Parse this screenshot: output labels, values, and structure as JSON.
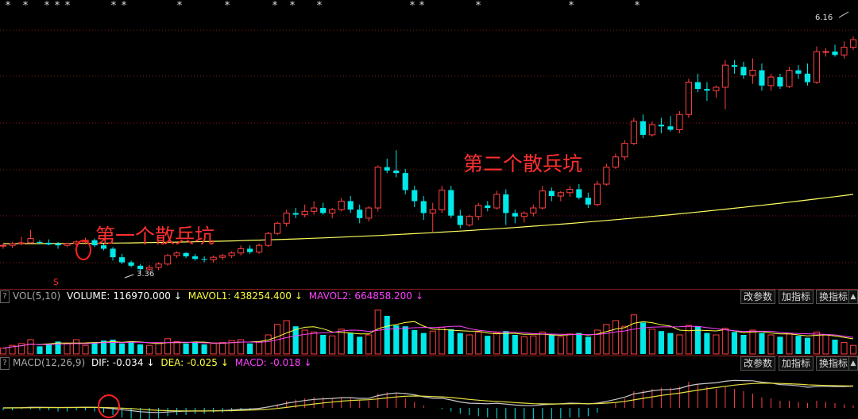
{
  "price_pane": {
    "annotations": [
      "第一个散兵坑",
      "第二个散兵坑"
    ],
    "high_label": "6.16",
    "low_label": "3.36",
    "marker_s": "S",
    "star_marks": [
      "*",
      "*",
      "*",
      "*",
      "*",
      "*",
      "*",
      "*",
      "*",
      "*",
      "*",
      "*",
      "*",
      "*",
      "*",
      "*",
      "*"
    ]
  },
  "vol_pane": {
    "indicator": "VOL(5,10)",
    "volume_label": "VOLUME:",
    "volume_value": "116970.000",
    "mavol1_label": "MAVOL1:",
    "mavol1_value": "438254.400",
    "mavol2_label": "MAVOL2:",
    "mavol2_value": "664858.200",
    "buttons": [
      "改参数",
      "加指标",
      "换指标"
    ]
  },
  "macd_pane": {
    "indicator": "MACD(12,26,9)",
    "dif_label": "DIF:",
    "dif_value": "-0.034",
    "dea_label": "DEA:",
    "dea_value": "-0.025",
    "macd_label": "MACD:",
    "macd_value": "-0.018",
    "buttons": [
      "改参数",
      "加指标",
      "换指标"
    ]
  },
  "colors": {
    "up": "#ff4040",
    "down": "#00e8e8",
    "ma_line": "#ffff60",
    "mavol1": "#ffff40",
    "mavol2": "#ff40ff",
    "dif": "#c8c8c8",
    "dea": "#e8e040",
    "annotation": "#ff3030"
  },
  "chart_data": {
    "type": "candlestick",
    "series": [
      {
        "name": "K",
        "ohlc": [
          [
            3.7,
            3.72,
            3.66,
            3.7
          ],
          [
            3.7,
            3.74,
            3.67,
            3.72
          ],
          [
            3.72,
            3.8,
            3.7,
            3.73
          ],
          [
            3.73,
            3.88,
            3.72,
            3.78
          ],
          [
            3.74,
            3.76,
            3.71,
            3.73
          ],
          [
            3.73,
            3.77,
            3.7,
            3.71
          ],
          [
            3.72,
            3.74,
            3.66,
            3.7
          ],
          [
            3.7,
            3.73,
            3.68,
            3.72
          ],
          [
            3.72,
            3.76,
            3.7,
            3.74
          ],
          [
            3.74,
            3.79,
            3.71,
            3.76
          ],
          [
            3.76,
            3.78,
            3.68,
            3.7
          ],
          [
            3.7,
            3.72,
            3.64,
            3.66
          ],
          [
            3.66,
            3.68,
            3.52,
            3.56
          ],
          [
            3.56,
            3.6,
            3.48,
            3.5
          ],
          [
            3.5,
            3.52,
            3.44,
            3.46
          ],
          [
            3.46,
            3.48,
            3.36,
            3.42
          ],
          [
            3.42,
            3.47,
            3.4,
            3.44
          ],
          [
            3.44,
            3.5,
            3.41,
            3.48
          ],
          [
            3.48,
            3.6,
            3.46,
            3.58
          ],
          [
            3.58,
            3.63,
            3.55,
            3.61
          ],
          [
            3.61,
            3.62,
            3.55,
            3.57
          ],
          [
            3.57,
            3.6,
            3.52,
            3.54
          ],
          [
            3.54,
            3.57,
            3.5,
            3.53
          ],
          [
            3.53,
            3.58,
            3.5,
            3.56
          ],
          [
            3.56,
            3.6,
            3.53,
            3.58
          ],
          [
            3.58,
            3.63,
            3.55,
            3.61
          ],
          [
            3.61,
            3.7,
            3.58,
            3.66
          ],
          [
            3.66,
            3.7,
            3.6,
            3.62
          ],
          [
            3.62,
            3.72,
            3.6,
            3.7
          ],
          [
            3.7,
            3.86,
            3.68,
            3.84
          ],
          [
            3.84,
            3.98,
            3.82,
            3.96
          ],
          [
            3.96,
            4.12,
            3.92,
            4.08
          ],
          [
            4.08,
            4.14,
            4.02,
            4.06
          ],
          [
            4.06,
            4.18,
            4.03,
            4.1
          ],
          [
            4.1,
            4.22,
            4.06,
            4.14
          ],
          [
            4.14,
            4.2,
            4.06,
            4.08
          ],
          [
            4.08,
            4.14,
            4.02,
            4.12
          ],
          [
            4.12,
            4.26,
            4.1,
            4.22
          ],
          [
            4.22,
            4.28,
            4.08,
            4.12
          ],
          [
            4.12,
            4.18,
            3.96,
            4.02
          ],
          [
            4.02,
            4.16,
            3.98,
            4.14
          ],
          [
            4.14,
            4.64,
            4.1,
            4.62
          ],
          [
            4.62,
            4.72,
            4.55,
            4.58
          ],
          [
            4.58,
            4.82,
            4.5,
            4.55
          ],
          [
            4.55,
            4.6,
            4.3,
            4.35
          ],
          [
            4.35,
            4.4,
            4.15,
            4.22
          ],
          [
            4.22,
            4.28,
            4.0,
            4.08
          ],
          [
            4.08,
            4.2,
            3.86,
            4.12
          ],
          [
            4.12,
            4.4,
            4.08,
            4.35
          ],
          [
            4.35,
            4.4,
            4.02,
            4.05
          ],
          [
            4.05,
            4.12,
            3.9,
            3.94
          ],
          [
            3.94,
            4.06,
            3.92,
            4.04
          ],
          [
            4.04,
            4.2,
            4.0,
            4.17
          ],
          [
            4.17,
            4.22,
            4.1,
            4.14
          ],
          [
            4.14,
            4.34,
            4.12,
            4.3
          ],
          [
            4.3,
            4.36,
            3.94,
            4.08
          ],
          [
            4.08,
            4.12,
            3.96,
            4.04
          ],
          [
            4.04,
            4.1,
            3.97,
            4.08
          ],
          [
            4.08,
            4.18,
            4.04,
            4.14
          ],
          [
            4.14,
            4.4,
            4.12,
            4.34
          ],
          [
            4.34,
            4.38,
            4.22,
            4.28
          ],
          [
            4.28,
            4.34,
            4.22,
            4.32
          ],
          [
            4.32,
            4.4,
            4.27,
            4.36
          ],
          [
            4.36,
            4.42,
            4.24,
            4.26
          ],
          [
            4.26,
            4.32,
            4.14,
            4.18
          ],
          [
            4.18,
            4.46,
            4.16,
            4.42
          ],
          [
            4.42,
            4.66,
            4.4,
            4.62
          ],
          [
            4.62,
            4.78,
            4.6,
            4.74
          ],
          [
            4.74,
            4.94,
            4.7,
            4.9
          ],
          [
            4.9,
            5.2,
            4.88,
            5.16
          ],
          [
            5.16,
            5.24,
            4.96,
            5.0
          ],
          [
            5.0,
            5.16,
            4.98,
            5.12
          ],
          [
            5.12,
            5.2,
            5.02,
            5.1
          ],
          [
            5.1,
            5.22,
            5.04,
            5.06
          ],
          [
            5.06,
            5.28,
            5.02,
            5.24
          ],
          [
            5.24,
            5.66,
            5.2,
            5.62
          ],
          [
            5.62,
            5.72,
            5.5,
            5.54
          ],
          [
            5.54,
            5.62,
            5.4,
            5.52
          ],
          [
            5.52,
            5.58,
            5.44,
            5.56
          ],
          [
            5.56,
            5.88,
            5.3,
            5.82
          ],
          [
            5.82,
            5.88,
            5.72,
            5.8
          ],
          [
            5.8,
            5.86,
            5.66,
            5.7
          ],
          [
            5.7,
            5.9,
            5.6,
            5.76
          ],
          [
            5.76,
            5.84,
            5.52,
            5.58
          ],
          [
            5.58,
            5.72,
            5.52,
            5.68
          ],
          [
            5.68,
            5.72,
            5.54,
            5.57
          ],
          [
            5.57,
            5.8,
            5.55,
            5.76
          ],
          [
            5.76,
            5.82,
            5.66,
            5.72
          ],
          [
            5.72,
            5.84,
            5.58,
            5.62
          ],
          [
            5.62,
            6.04,
            5.6,
            5.98
          ],
          [
            5.98,
            6.02,
            5.92,
            5.98
          ],
          [
            5.98,
            6.06,
            5.92,
            5.94
          ],
          [
            5.94,
            6.1,
            5.9,
            6.03
          ],
          [
            6.03,
            6.16,
            6.0,
            6.12
          ]
        ]
      },
      {
        "name": "MA",
        "values_hint": "long moving average rising from 3.72 to 4.30"
      },
      {
        "name": "VOLUME",
        "values": [
          12,
          18,
          22,
          30,
          16,
          20,
          26,
          22,
          30,
          18,
          24,
          28,
          30,
          22,
          26,
          20,
          18,
          22,
          32,
          26,
          22,
          24,
          20,
          22,
          24,
          28,
          30,
          22,
          26,
          40,
          62,
          70,
          58,
          50,
          46,
          40,
          38,
          52,
          44,
          36,
          40,
          92,
          80,
          60,
          58,
          50,
          44,
          48,
          56,
          52,
          44,
          40,
          46,
          38,
          44,
          48,
          40,
          36,
          38,
          46,
          40,
          36,
          42,
          44,
          36,
          50,
          62,
          70,
          58,
          82,
          66,
          52,
          48,
          44,
          40,
          60,
          58,
          44,
          40,
          54,
          46,
          40,
          50,
          44,
          40,
          36,
          42,
          38,
          34,
          46,
          40,
          30,
          24,
          18
        ]
      },
      {
        "name": "MACD",
        "values": [
          -0.02,
          -0.02,
          -0.01,
          -0.01,
          -0.02,
          -0.02,
          -0.03,
          -0.03,
          -0.02,
          -0.02,
          -0.03,
          -0.04,
          -0.06,
          -0.08,
          -0.09,
          -0.1,
          -0.1,
          -0.09,
          -0.07,
          -0.06,
          -0.06,
          -0.05,
          -0.05,
          -0.04,
          -0.04,
          -0.03,
          -0.02,
          -0.02,
          -0.01,
          0.01,
          0.03,
          0.06,
          0.07,
          0.08,
          0.09,
          0.09,
          0.08,
          0.09,
          0.08,
          0.06,
          0.06,
          0.12,
          0.13,
          0.12,
          0.08,
          0.05,
          0.02,
          0.0,
          -0.01,
          -0.03,
          -0.05,
          -0.06,
          -0.07,
          -0.08,
          -0.09,
          -0.11,
          -0.12,
          -0.13,
          -0.12,
          -0.1,
          -0.1,
          -0.09,
          -0.08,
          -0.08,
          -0.07,
          -0.04,
          0.0,
          0.04,
          0.08,
          0.14,
          0.15,
          0.16,
          0.17,
          0.17,
          0.18,
          0.22,
          0.2,
          0.18,
          0.16,
          0.18,
          0.16,
          0.14,
          0.12,
          0.09,
          0.08,
          0.06,
          0.06,
          0.05,
          0.04,
          0.06,
          0.05,
          0.04,
          0.03,
          0.02
        ]
      }
    ]
  }
}
